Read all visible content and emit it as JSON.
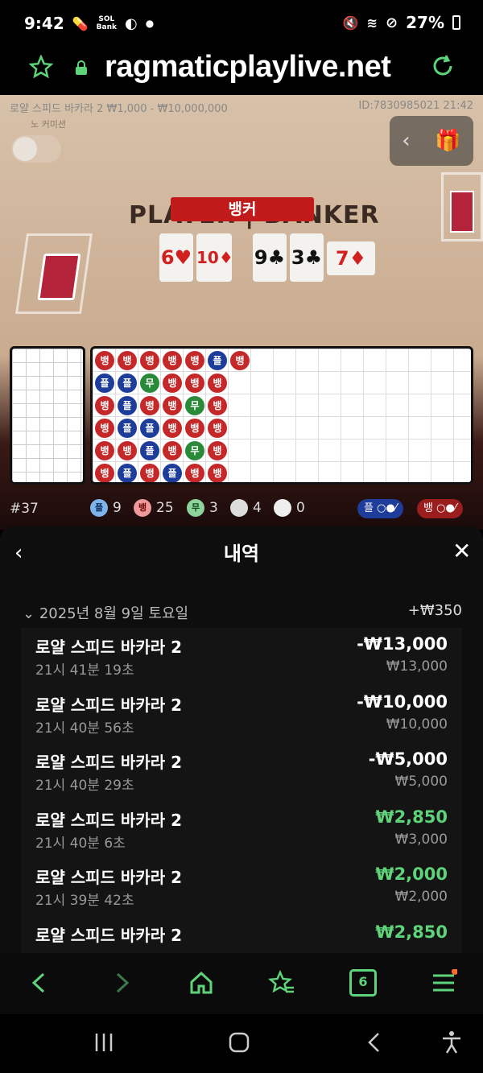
{
  "status": {
    "time": "9:42",
    "battery": "27%",
    "bank_label": "Bank"
  },
  "browser": {
    "url": "ragmaticplaylive.net"
  },
  "game": {
    "title_info": "로얄 스피드 바카라 2  ₩1,000 - ₩10,000,000",
    "id_info": "ID:7830985021  21:42",
    "no_commission": "노 커미션",
    "table_text": "PLAYER | BANKER",
    "result_banner": "뱅커",
    "player_cards": [
      "6♥",
      "10♦"
    ],
    "banker_cards": [
      "9♣",
      "3♣",
      "7♦"
    ],
    "bead_grid": [
      [
        "뱅",
        "뱅",
        "뱅",
        "뱅",
        "뱅",
        "플",
        "뱅"
      ],
      [
        "플",
        "플",
        "무",
        "뱅",
        "뱅",
        "뱅"
      ],
      [
        "뱅",
        "플",
        "뱅",
        "뱅",
        "무",
        "뱅"
      ],
      [
        "뱅",
        "플",
        "플",
        "뱅",
        "뱅",
        "뱅"
      ],
      [
        "뱅",
        "뱅",
        "플",
        "뱅",
        "무",
        "뱅"
      ],
      [
        "뱅",
        "플",
        "뱅",
        "플",
        "뱅",
        "뱅"
      ]
    ],
    "stats": {
      "round": "#37",
      "player_label": "플",
      "player": "9",
      "banker_label": "뱅",
      "banker": "25",
      "tie_label": "무",
      "tie": "3",
      "pp": "4",
      "bp": "0",
      "player_pill": "플",
      "banker_pill": "뱅"
    }
  },
  "panel": {
    "title": "내역",
    "date": "2025년 8월 9일 토요일",
    "date_total": "+₩350",
    "items": [
      {
        "name": "로얄 스피드 바카라 2",
        "time": "21시 41분 19초",
        "amount": "-₩13,000",
        "bet": "₩13,000",
        "positive": false
      },
      {
        "name": "로얄 스피드 바카라 2",
        "time": "21시 40분 56초",
        "amount": "-₩10,000",
        "bet": "₩10,000",
        "positive": false
      },
      {
        "name": "로얄 스피드 바카라 2",
        "time": "21시 40분 29초",
        "amount": "-₩5,000",
        "bet": "₩5,000",
        "positive": false
      },
      {
        "name": "로얄 스피드 바카라 2",
        "time": "21시 40분 6초",
        "amount": "₩2,850",
        "bet": "₩3,000",
        "positive": true
      },
      {
        "name": "로얄 스피드 바카라 2",
        "time": "21시 39분 42초",
        "amount": "₩2,000",
        "bet": "₩2,000",
        "positive": true
      },
      {
        "name": "로얄 스피드 바카라 2",
        "time": "",
        "amount": "₩2,850",
        "bet": "",
        "positive": true
      }
    ]
  },
  "bottom_nav": {
    "tabs_count": "6"
  },
  "colors": {
    "accent": "#5fd37a",
    "banker": "#c42828",
    "player": "#1e3c9a",
    "tie": "#2b8a3a"
  }
}
